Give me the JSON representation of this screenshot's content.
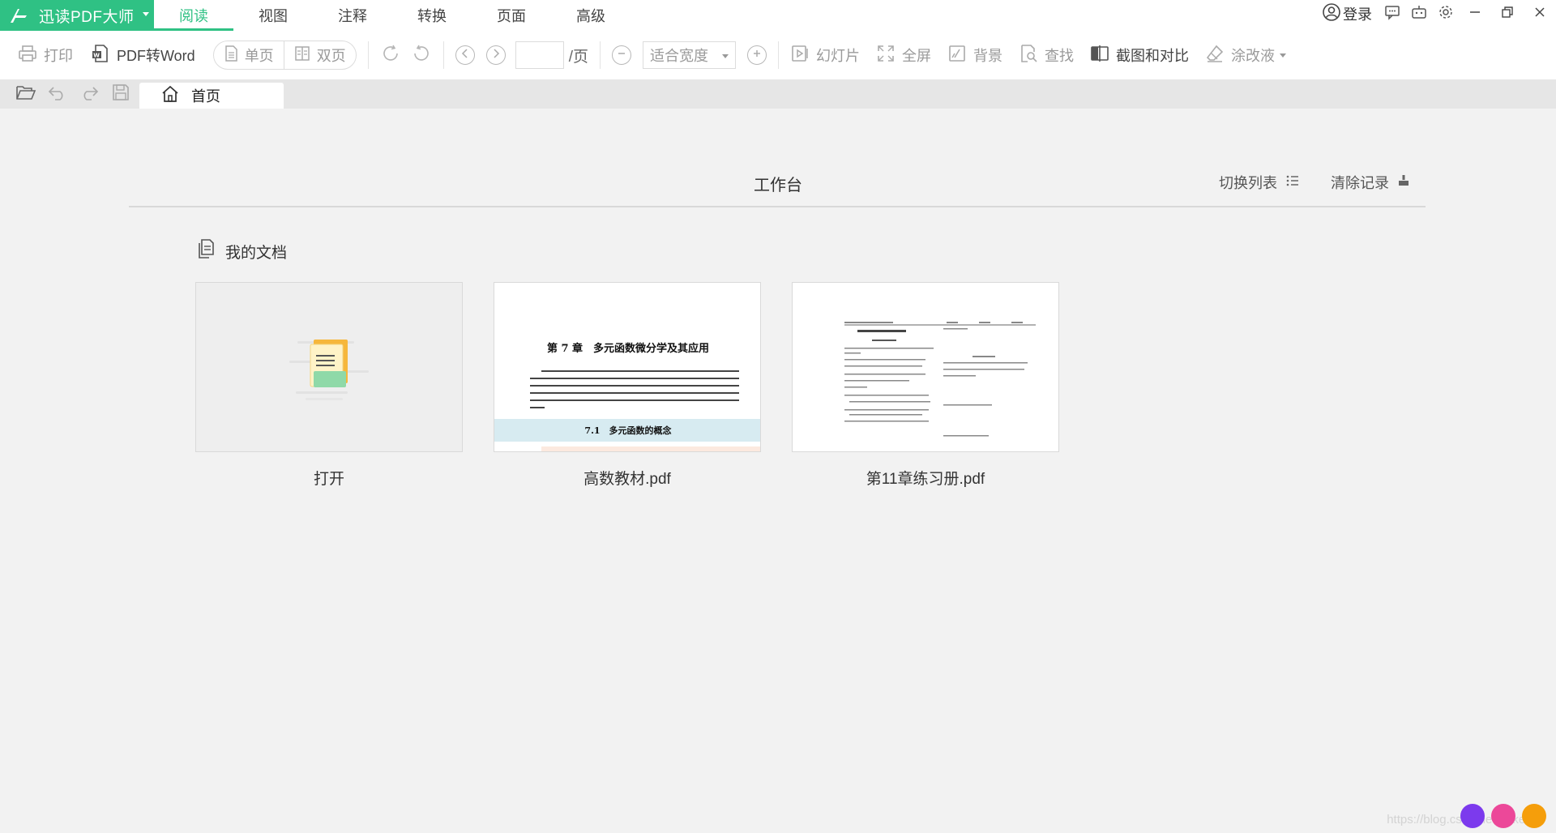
{
  "app": {
    "name": "迅读PDF大师",
    "brand_color": "#2fc184",
    "menu_tabs": [
      "阅读",
      "视图",
      "注释",
      "转换",
      "页面",
      "高级"
    ],
    "active_tab": "阅读",
    "login_label": "登录"
  },
  "toolbar": {
    "print_label": "打印",
    "pdf_to_word_label": "PDF转Word",
    "single_page_label": "单页",
    "double_page_label": "双页",
    "page_input_value": "",
    "page_suffix": "/页",
    "zoom_value": "适合宽度",
    "slideshow_label": "幻灯片",
    "fullscreen_label": "全屏",
    "background_label": "背景",
    "find_label": "查找",
    "screenshot_compare_label": "截图和对比",
    "correction_label": "涂改液"
  },
  "tabs": {
    "home_label": "首页"
  },
  "workspace": {
    "title": "工作台",
    "switch_list_label": "切换列表",
    "clear_history_label": "清除记录",
    "my_docs_label": "我的文档",
    "cards": [
      {
        "caption": "打开"
      },
      {
        "caption": "高数教材.pdf",
        "page_heading": "第 7 章　多元函数微分学及其应用",
        "section_heading": "7.1　多元函数的概念"
      },
      {
        "caption": "第11章练习册.pdf"
      }
    ]
  },
  "watermark": {
    "text": "https://blog.csdn.net/Lakersl"
  }
}
